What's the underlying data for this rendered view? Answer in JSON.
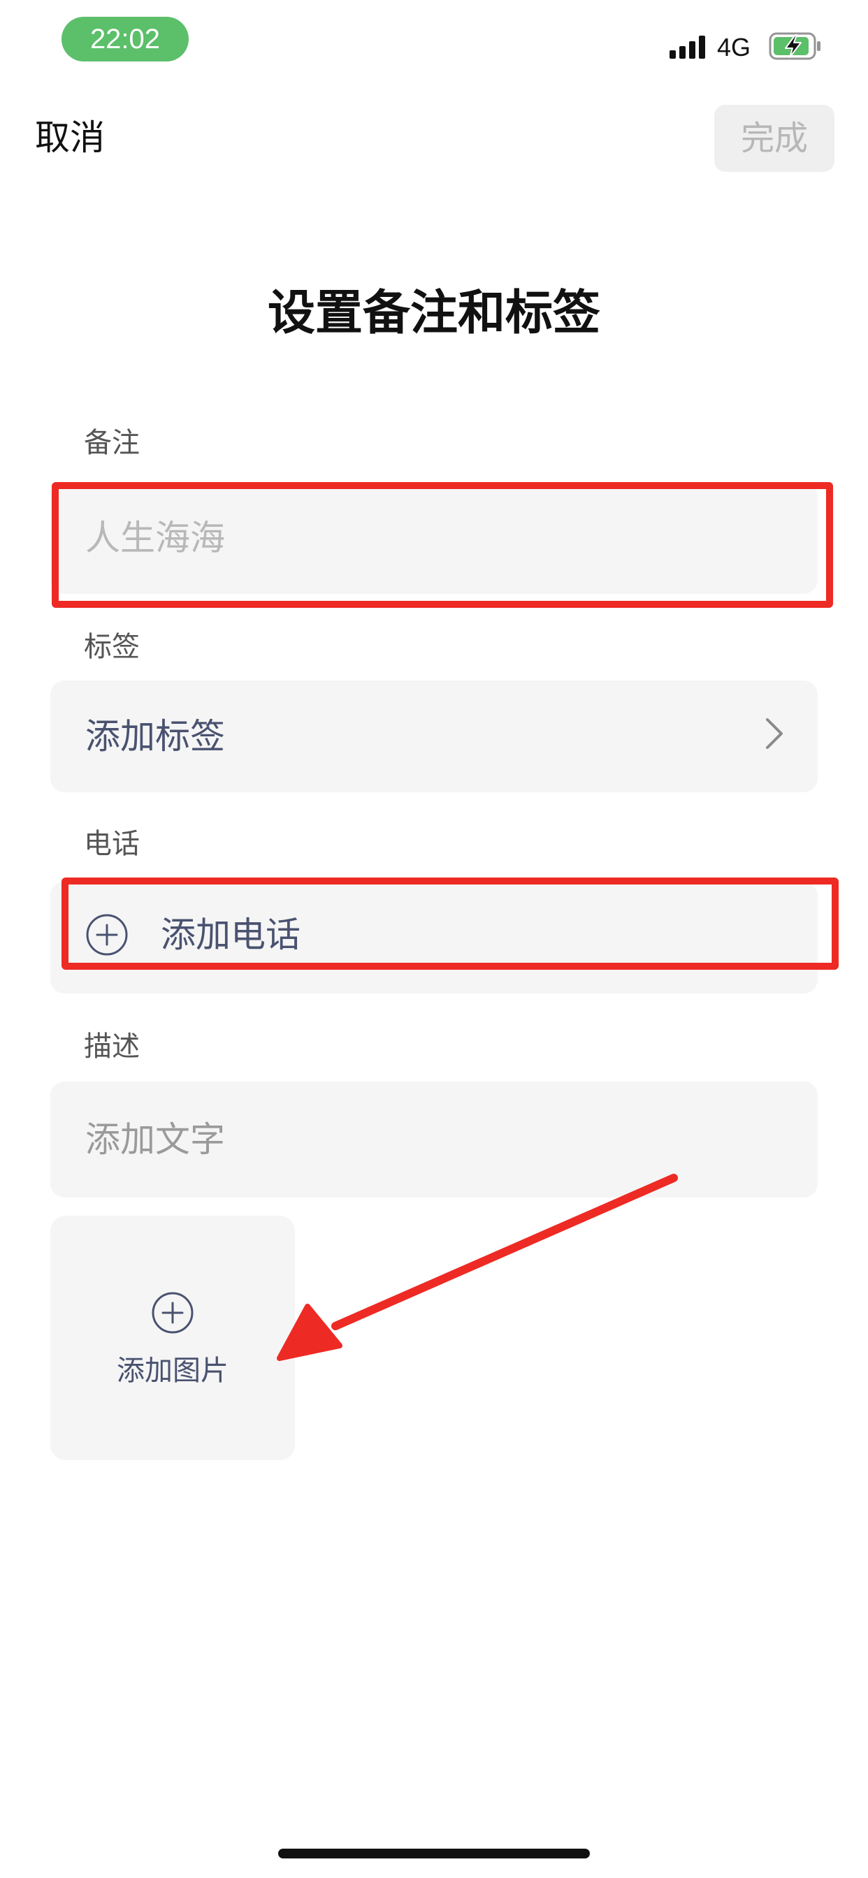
{
  "status_bar": {
    "time": "22:02",
    "network": "4G",
    "icons": [
      "signal-icon",
      "battery-charging-icon"
    ]
  },
  "nav": {
    "cancel_label": "取消",
    "done_label": "完成"
  },
  "title": "设置备注和标签",
  "fields": {
    "remark": {
      "label": "备注",
      "placeholder": "人生海海"
    },
    "tags": {
      "label": "标签",
      "action": "添加标签",
      "icon": "chevron-right-icon"
    },
    "phone": {
      "label": "电话",
      "action": "添加电话",
      "icon": "plus-circle-icon"
    },
    "description": {
      "label": "描述",
      "placeholder": "添加文字"
    },
    "image": {
      "action": "添加图片",
      "icon": "plus-circle-icon"
    }
  },
  "colors": {
    "status_time_bg": "#5cbf6a",
    "field_bg": "#f5f5f5",
    "link_text": "#4a5270",
    "annotation_red": "#ee2a24",
    "done_disabled_bg": "#efefef"
  }
}
